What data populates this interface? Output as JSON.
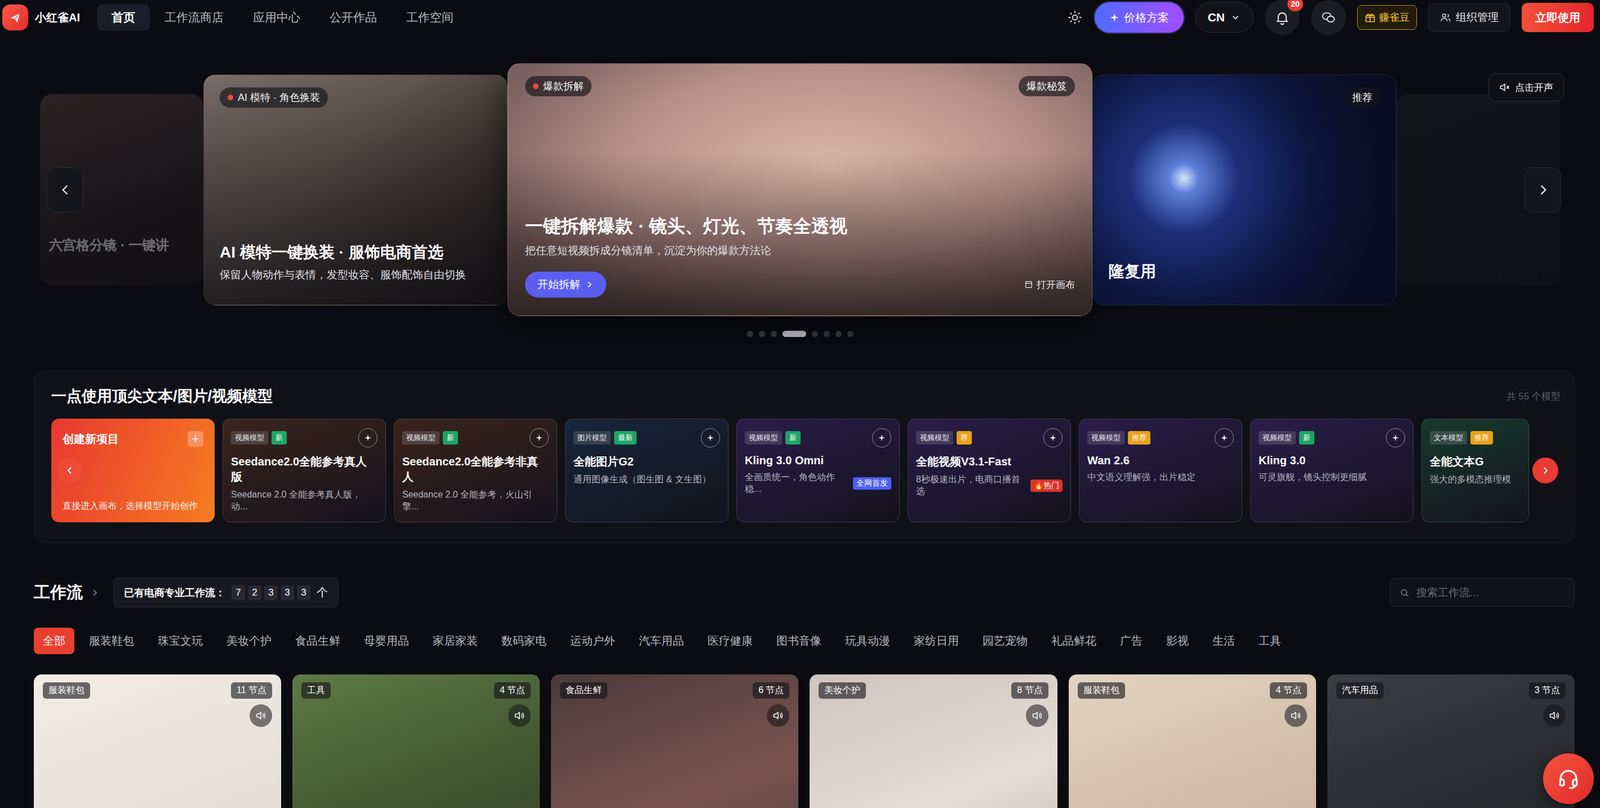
{
  "logo": {
    "text": "小红雀AI"
  },
  "nav": {
    "items": [
      {
        "label": "首页",
        "selected": true
      },
      {
        "label": "工作流商店",
        "selected": false
      },
      {
        "label": "应用中心",
        "selected": false
      },
      {
        "label": "公开作品",
        "selected": false
      },
      {
        "label": "工作空间",
        "selected": false
      }
    ]
  },
  "toolbar": {
    "pricing": "价格方案",
    "language": "CN",
    "notification_count": "20",
    "earn": "赚雀豆",
    "organization": "组织管理",
    "cta": "立即使用"
  },
  "hero": {
    "sound_button": "点击开声",
    "slides": [
      {
        "kind": "faded",
        "title": "六宫格分镜 · 一键讲"
      },
      {
        "kind": "side",
        "tag": "AI 模特 · 角色换装",
        "title": "AI 模特一键换装 · 服饰电商首选",
        "subtitle": "保留人物动作与表情，发型妆容、服饰配饰自由切换"
      },
      {
        "kind": "center",
        "tag": "爆款拆解",
        "badge": "爆款秘笈",
        "title": "一键拆解爆款 · 镜头、灯光、节奏全透视",
        "subtitle": "把任意短视频拆成分镜清单，沉淀为你的爆款方法论",
        "button": "开始拆解",
        "link": "打开画布"
      },
      {
        "kind": "side",
        "badge": "推荐",
        "title": "隆复用"
      },
      {
        "kind": "faded"
      }
    ],
    "dots": [
      {
        "selected": false
      },
      {
        "selected": false
      },
      {
        "selected": false
      },
      {
        "selected": true
      },
      {
        "selected": false
      },
      {
        "selected": false
      },
      {
        "selected": false
      },
      {
        "selected": false
      }
    ]
  },
  "models": {
    "title": "一点使用顶尖文本/图片/视频模型",
    "count": "共 55 个模型",
    "create": {
      "title": "创建新项目",
      "icon": "+",
      "description": "直接进入画布，选择模型开始创作"
    },
    "items": [
      {
        "type": "视频模型",
        "badge": "新",
        "badge_color": "#1fa463",
        "name": "Seedance2.0全能参考真人版",
        "description": "Seedance 2.0 全能参考真人版，动...",
        "color": "#3b241c"
      },
      {
        "type": "视频模型",
        "badge": "新",
        "badge_color": "#1fa463",
        "name": "Seedance2.0全能参考非真人",
        "description": "Seedance 2.0 全能参考，火山引擎...",
        "color": "#3b241c"
      },
      {
        "type": "图片模型",
        "badge": "最新",
        "badge_color": "#1fa463",
        "name": "全能图片G2",
        "description": "通用图像生成（图生图 & 文生图）",
        "color": "#16263a"
      },
      {
        "type": "视频模型",
        "badge": "新",
        "badge_color": "#1fa463",
        "name": "Kling 3.0 Omni",
        "description": "全画质统一，角色动作稳...",
        "color": "#2a1d4a",
        "flag": {
          "text": "全网首发",
          "color": "#4d5ef0"
        }
      },
      {
        "type": "视频模型",
        "badge": "荐",
        "badge_color": "#e8a21a",
        "name": "全能视频V3.1-Fast",
        "description": "8秒极速出片，电商口播首选",
        "color": "#2a1d4a",
        "flag": {
          "text": "🔥热门",
          "color": "#d9342b"
        }
      },
      {
        "type": "视频模型",
        "badge": "推荐",
        "badge_color": "#e8a21a",
        "name": "Wan 2.6",
        "description": "中文语义理解强，出片稳定",
        "color": "#2a1d4a"
      },
      {
        "type": "视频模型",
        "badge": "新",
        "badge_color": "#1fa463",
        "name": "Kling 3.0",
        "description": "可灵旗舰，镜头控制更细腻",
        "color": "#2a1d4a"
      },
      {
        "type": "文本模型",
        "badge": "推荐",
        "badge_color": "#e8a21a",
        "name": "全能文本G",
        "description": "强大的多模态推理模",
        "color": "#173a2c"
      }
    ]
  },
  "workflows": {
    "title": "工作流",
    "counter": {
      "label": "已有电商专业工作流：",
      "digits": [
        "7",
        "2",
        "3",
        "3",
        "3"
      ],
      "unit": "个"
    },
    "search_placeholder": "搜索工作流...",
    "categories": [
      {
        "label": "全部",
        "selected": true
      },
      {
        "label": "服装鞋包",
        "selected": false
      },
      {
        "label": "珠宝文玩",
        "selected": false
      },
      {
        "label": "美妆个护",
        "selected": false
      },
      {
        "label": "食品生鲜",
        "selected": false
      },
      {
        "label": "母婴用品",
        "selected": false
      },
      {
        "label": "家居家装",
        "selected": false
      },
      {
        "label": "数码家电",
        "selected": false
      },
      {
        "label": "运动户外",
        "selected": false
      },
      {
        "label": "汽车用品",
        "selected": false
      },
      {
        "label": "医疗健康",
        "selected": false
      },
      {
        "label": "图书音像",
        "selected": false
      },
      {
        "label": "玩具动漫",
        "selected": false
      },
      {
        "label": "家纺日用",
        "selected": false
      },
      {
        "label": "园艺宠物",
        "selected": false
      },
      {
        "label": "礼品鲜花",
        "selected": false
      },
      {
        "label": "广告",
        "selected": false
      },
      {
        "label": "影视",
        "selected": false
      },
      {
        "label": "生活",
        "selected": false
      },
      {
        "label": "工具",
        "selected": false
      }
    ],
    "cards": [
      {
        "category": "服装鞋包",
        "nodes": "11 节点"
      },
      {
        "category": "工具",
        "nodes": "4 节点"
      },
      {
        "category": "食品生鲜",
        "nodes": "6 节点"
      },
      {
        "category": "美妆个护",
        "nodes": "8 节点"
      },
      {
        "category": "服装鞋包",
        "nodes": "4 节点"
      },
      {
        "category": "汽车用品",
        "nodes": "3 节点"
      }
    ]
  }
}
